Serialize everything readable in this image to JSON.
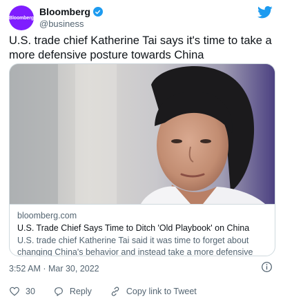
{
  "header": {
    "avatar_text": "Bloomberg",
    "display_name": "Bloomberg",
    "handle": "@business"
  },
  "tweet": {
    "text": "U.S. trade chief Katherine Tai says it's time to take a more defensive posture towards China"
  },
  "card": {
    "domain": "bloomberg.com",
    "title": "U.S. Trade Chief Says Time to Ditch 'Old Playbook' on China",
    "description": "U.S. trade chief Katherine Tai said it was time to forget about changing China's behavior and instead take a more defensive posture toward the ..."
  },
  "timestamp": "3:52 AM · Mar 30, 2022",
  "actions": {
    "like_count": "30",
    "reply_label": "Reply",
    "copy_link_label": "Copy link to Tweet"
  },
  "icons": {
    "verified": "verified-badge-icon",
    "twitter": "twitter-bird-icon",
    "info": "info-icon",
    "like": "heart-icon",
    "reply": "speech-bubble-icon",
    "copy_link": "link-icon"
  },
  "colors": {
    "brand_blue": "#1d9bf0",
    "avatar_purple": "#7f1dff",
    "text_primary": "#0f1419",
    "text_secondary": "#536471",
    "border": "#cfd9de"
  }
}
